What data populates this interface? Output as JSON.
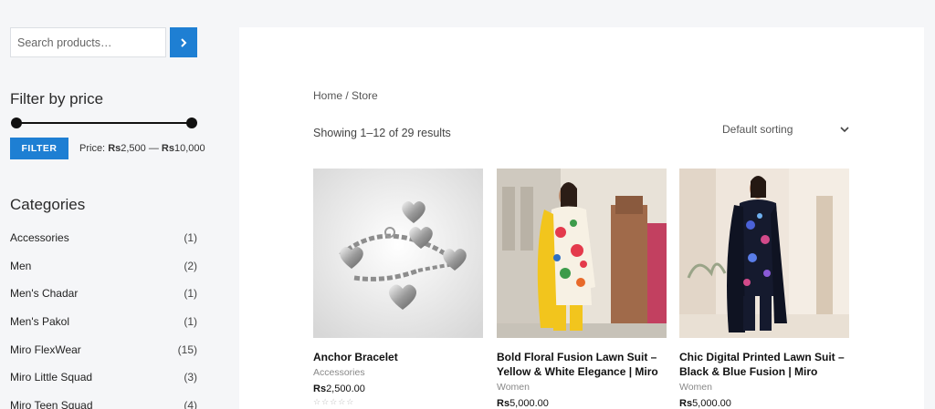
{
  "search": {
    "placeholder": "Search products…"
  },
  "price_filter": {
    "title": "Filter by price",
    "button_label": "FILTER",
    "price_prefix": "Price:",
    "min_currency": "Rs",
    "min_value": "2,500",
    "separator": "—",
    "max_currency": "Rs",
    "max_value": "10,000"
  },
  "categories": {
    "title": "Categories",
    "items": [
      {
        "label": "Accessories",
        "count": "(1)"
      },
      {
        "label": "Men",
        "count": "(2)"
      },
      {
        "label": "Men's Chadar",
        "count": "(1)"
      },
      {
        "label": "Men's Pakol",
        "count": "(1)"
      },
      {
        "label": "Miro FlexWear",
        "count": "(15)"
      },
      {
        "label": "Miro Little Squad",
        "count": "(3)"
      },
      {
        "label": "Miro Teen Squad",
        "count": "(4)"
      }
    ]
  },
  "breadcrumb": {
    "home": "Home",
    "sep": " / ",
    "current": "Store"
  },
  "results": {
    "text": "Showing 1–12 of 29 results"
  },
  "sorting": {
    "selected": "Default sorting"
  },
  "products": [
    {
      "title": "Anchor Bracelet",
      "category": "Accessories",
      "currency": "Rs",
      "price": "2,500.00"
    },
    {
      "title": "Bold Floral Fusion Lawn Suit – Yellow & White Elegance | Miro",
      "category": "Women",
      "currency": "Rs",
      "price": "5,000.00"
    },
    {
      "title": "Chic Digital Printed Lawn Suit – Black & Blue Fusion | Miro",
      "category": "Women",
      "currency": "Rs",
      "price": "5,000.00"
    }
  ],
  "colors": {
    "accent": "#1e7fd3",
    "page_bg": "#f5f6f8"
  },
  "icons": {
    "search_button": "chevron-right-icon",
    "sort": "chevron-down-icon"
  }
}
